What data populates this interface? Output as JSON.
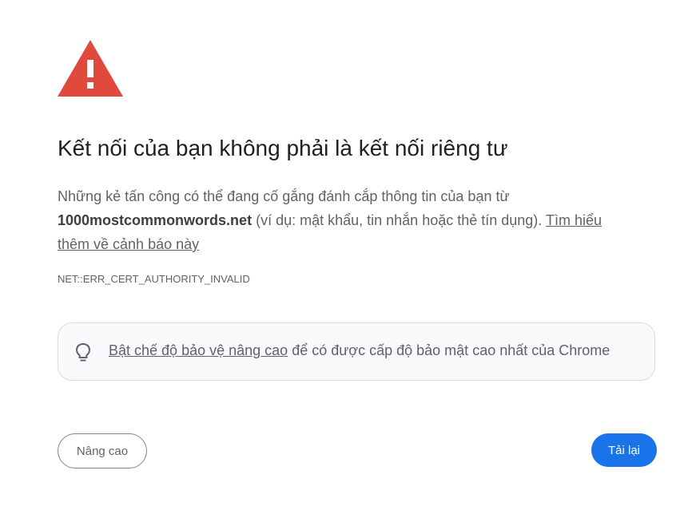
{
  "page": {
    "title": "Kết nối của bạn không phải là kết nối riêng tư",
    "description_part1": "Những kẻ tấn công có thể đang cố gắng đánh cắp thông tin của bạn từ",
    "domain": "1000mostcommonwords.net",
    "description_part2": "(ví dụ: mật khẩu, tin nhắn hoặc thẻ tín dụng).",
    "learn_more_link": "Tìm hiểu thêm về cảnh báo này",
    "error_code": "NET::ERR_CERT_AUTHORITY_INVALID"
  },
  "enhanced_protection": {
    "icon": "lightbulb-icon",
    "link_text": "Bật chế độ bảo vệ nâng cao",
    "text": "để có được cấp độ bảo mật cao nhất của Chrome"
  },
  "buttons": {
    "advanced_label": "Nâng cao",
    "reload_label": "Tải lại"
  },
  "colors": {
    "warning_red": "#e04a3c",
    "primary_blue": "#1a73e8",
    "text_primary": "#202124",
    "text_secondary": "#5f6368",
    "box_background": "#f8f9fa"
  },
  "icons": {
    "warning": "warning-triangle-icon"
  }
}
